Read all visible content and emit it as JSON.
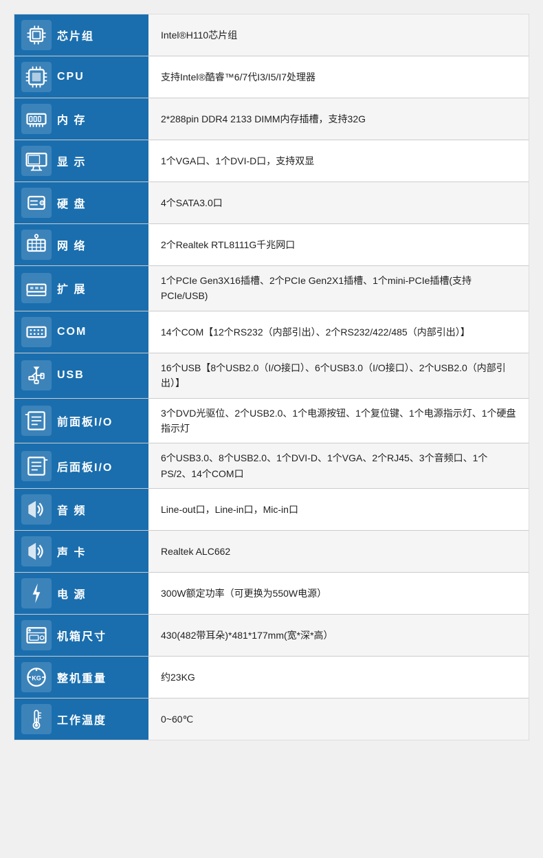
{
  "rows": [
    {
      "id": "chipset",
      "icon": "🔲",
      "iconUnicode": "chip",
      "label": "芯片组",
      "value": "Intel®H110芯片组"
    },
    {
      "id": "cpu",
      "icon": "🖥",
      "iconUnicode": "cpu",
      "label": "CPU",
      "value": "支持Intel®酷睿™6/7代I3/I5/I7处理器"
    },
    {
      "id": "memory",
      "icon": "💾",
      "iconUnicode": "memory",
      "label": "内 存",
      "value": "2*288pin DDR4 2133 DIMM内存插槽，支持32G"
    },
    {
      "id": "display",
      "icon": "🖥",
      "iconUnicode": "display",
      "label": "显 示",
      "value": "1个VGA口、1个DVI-D口，支持双显"
    },
    {
      "id": "harddisk",
      "icon": "💿",
      "iconUnicode": "harddisk",
      "label": "硬 盘",
      "value": "4个SATA3.0口"
    },
    {
      "id": "network",
      "icon": "🌐",
      "iconUnicode": "network",
      "label": "网 络",
      "value": "2个Realtek RTL8111G千兆网口"
    },
    {
      "id": "expansion",
      "icon": "🔌",
      "iconUnicode": "expansion",
      "label": "扩 展",
      "value": "1个PCIe Gen3X16插槽、2个PCIe Gen2X1插槽、1个mini-PCIe插槽(支持PCIe/USB)"
    },
    {
      "id": "com",
      "icon": "📡",
      "iconUnicode": "com",
      "label": "COM",
      "value": "14个COM【12个RS232（内部引出）、2个RS232/422/485（内部引出）】"
    },
    {
      "id": "usb",
      "icon": "🔗",
      "iconUnicode": "usb",
      "label": "USB",
      "value": "16个USB【8个USB2.0（I/O接口）、6个USB3.0（I/O接口）、2个USB2.0（内部引出）】"
    },
    {
      "id": "front-io",
      "icon": "📋",
      "iconUnicode": "front-panel",
      "label": "前面板I/O",
      "value": "3个DVD光驱位、2个USB2.0、1个电源按钮、1个复位键、1个电源指示灯、1个硬盘指示灯"
    },
    {
      "id": "rear-io",
      "icon": "📋",
      "iconUnicode": "rear-panel",
      "label": "后面板I/O",
      "value": "6个USB3.0、8个USB2.0、1个DVI-D、1个VGA、2个RJ45、3个音频口、1个PS/2、14个COM口"
    },
    {
      "id": "audio",
      "icon": "🔊",
      "iconUnicode": "audio",
      "label": "音 频",
      "value": "Line-out口，Line-in口，Mic-in口"
    },
    {
      "id": "soundcard",
      "icon": "🔊",
      "iconUnicode": "soundcard",
      "label": "声 卡",
      "value": "Realtek ALC662"
    },
    {
      "id": "power",
      "icon": "⚡",
      "iconUnicode": "power",
      "label": "电 源",
      "value": "300W额定功率（可更换为550W电源）"
    },
    {
      "id": "chassis",
      "icon": "📦",
      "iconUnicode": "chassis",
      "label": "机箱尺寸",
      "value": "430(482带耳朵)*481*177mm(宽*深*高）"
    },
    {
      "id": "weight",
      "icon": "⚖",
      "iconUnicode": "weight",
      "label": "整机重量",
      "value": "约23KG"
    },
    {
      "id": "temperature",
      "icon": "🌡",
      "iconUnicode": "temperature",
      "label": "工作温度",
      "value": "0~60℃"
    }
  ],
  "icons": {
    "chip": "▦",
    "cpu": "▣",
    "memory": "▬",
    "display": "▭",
    "harddisk": "◉",
    "network": "⬡",
    "expansion": "⊞",
    "com": "≡",
    "usb": "⇌",
    "front-panel": "▱",
    "rear-panel": "▱",
    "audio": "◀",
    "soundcard": "◀",
    "power": "⚡",
    "chassis": "⬛",
    "weight": "⊕",
    "temperature": "♨"
  }
}
